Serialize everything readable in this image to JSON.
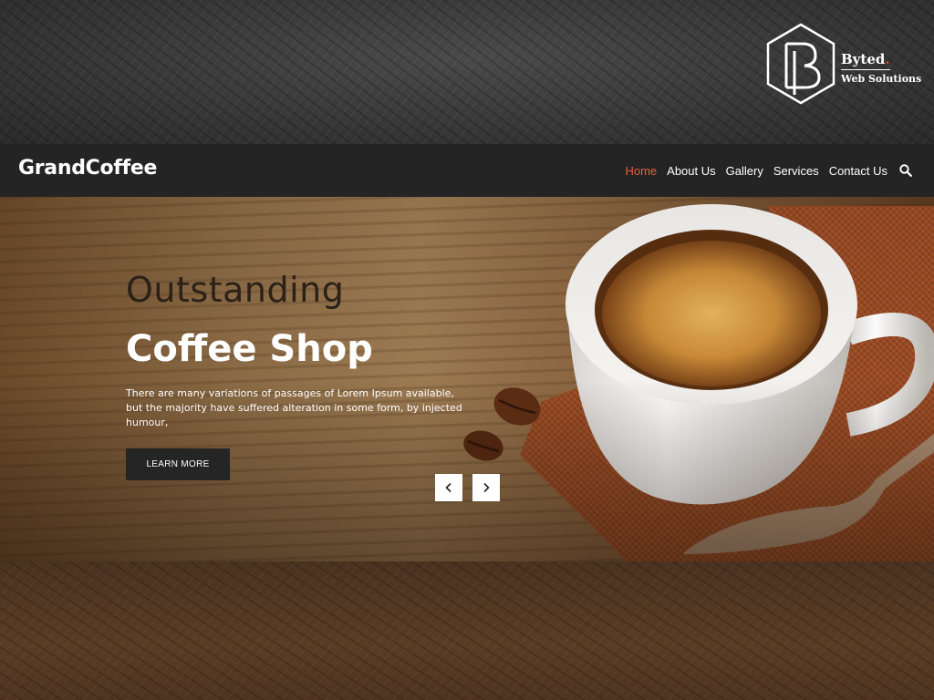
{
  "brand": {
    "name": "Byted",
    "dot": ".",
    "subtitle": "Web Solutions"
  },
  "site": {
    "logo": "GrandCoffee"
  },
  "nav": {
    "items": [
      {
        "label": "Home",
        "active": true
      },
      {
        "label": "About Us",
        "active": false
      },
      {
        "label": "Gallery",
        "active": false
      },
      {
        "label": "Services",
        "active": false
      },
      {
        "label": "Contact Us",
        "active": false
      }
    ],
    "search_icon": "search-icon"
  },
  "hero": {
    "title_line1": "Outstanding",
    "title_line2": "Coffee Shop",
    "description": "There are many variations of passages of Lorem Ipsum available, but the majority have suffered alteration in some form, by injected humour,",
    "button_label": "LEARN MORE",
    "prev_icon": "chevron-left-icon",
    "next_icon": "chevron-right-icon"
  },
  "colors": {
    "accent": "#e8603a",
    "navbar": "#242424",
    "button": "#252525"
  }
}
